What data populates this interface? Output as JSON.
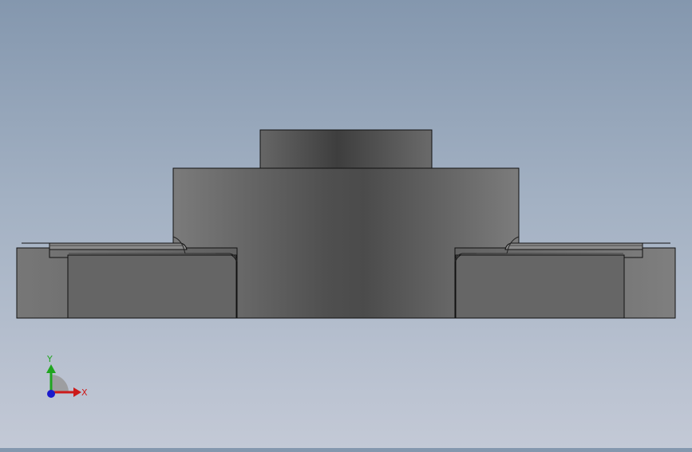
{
  "viewport": {
    "background_top": "#8497ae",
    "background_bottom": "#c3c9d6"
  },
  "model": {
    "body_color": "#6a6a6a",
    "edge_color": "#111111"
  },
  "triad": {
    "x_label": "X",
    "y_label": "Y",
    "x_color": "#cc1a1a",
    "y_color": "#1fa51f",
    "z_color": "#1a1acc"
  }
}
